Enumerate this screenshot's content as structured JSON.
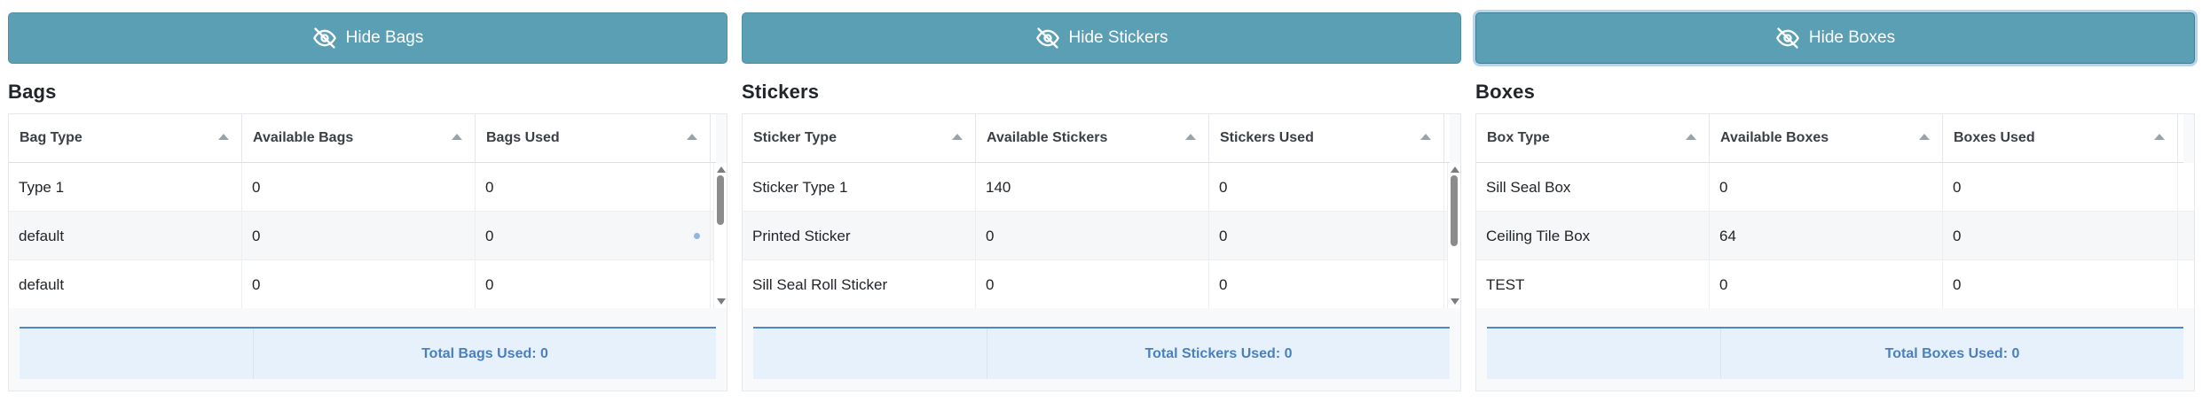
{
  "panels": {
    "bags": {
      "button_label": "Hide Bags",
      "title": "Bags",
      "columns": [
        "Bag Type",
        "Available Bags",
        "Bags Used"
      ],
      "rows": [
        [
          "Type 1",
          "0",
          "0"
        ],
        [
          "default",
          "0",
          "0"
        ],
        [
          "default",
          "0",
          "0"
        ]
      ],
      "footer": "Total Bags Used: 0"
    },
    "stickers": {
      "button_label": "Hide Stickers",
      "title": "Stickers",
      "columns": [
        "Sticker Type",
        "Available Stickers",
        "Stickers Used"
      ],
      "rows": [
        [
          "Sticker Type 1",
          "140",
          "0"
        ],
        [
          "Printed Sticker",
          "0",
          "0"
        ],
        [
          "Sill Seal Roll Sticker",
          "0",
          "0"
        ]
      ],
      "footer": "Total Stickers Used: 0"
    },
    "boxes": {
      "button_label": "Hide Boxes",
      "title": "Boxes",
      "columns": [
        "Box Type",
        "Available Boxes",
        "Boxes Used"
      ],
      "rows": [
        [
          "Sill Seal Box",
          "0",
          "0"
        ],
        [
          "Ceiling Tile Box",
          "64",
          "0"
        ],
        [
          "TEST",
          "0",
          "0"
        ]
      ],
      "footer": "Total Boxes Used: 0"
    }
  },
  "icons": {
    "hide_button": "eye-slash-icon",
    "sort": "sort-ascending-icon"
  },
  "colors": {
    "button_bg": "#5b9fb5",
    "footer_bg": "#e7f1fb",
    "footer_text": "#4a7fc0"
  }
}
